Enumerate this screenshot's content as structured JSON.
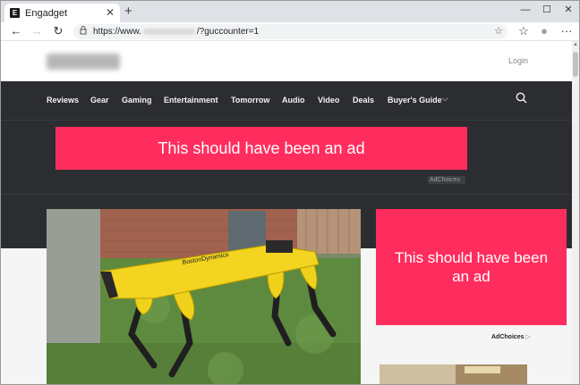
{
  "browser": {
    "tab_title": "Engadget",
    "tab_favicon": "E",
    "tab_close": "✕",
    "new_tab": "+",
    "window_controls": {
      "minimize": "—",
      "maximize": "☐",
      "close": "✕"
    },
    "nav_buttons": {
      "back": "←",
      "forward": "→",
      "reload": "↻"
    },
    "url_prefix": "https://www.",
    "url_suffix": "/?guccounter=1",
    "toolbar_right": {
      "favorites": "☆",
      "collections": "☆",
      "profile": "●",
      "more": "···"
    }
  },
  "site": {
    "login_label": "Login",
    "nav_items": [
      "Reviews",
      "Gear",
      "Gaming",
      "Entertainment",
      "Tomorrow",
      "Audio",
      "Video",
      "Deals",
      "Buyer's Guide"
    ],
    "nav_dropdown": "⌵",
    "search_icon": "⌕"
  },
  "ads": {
    "top_text": "This should have been an ad",
    "top_adchoices": "AdChoices",
    "side_text": "This should have been an ad",
    "side_adchoices": "AdChoices",
    "side_adchoices_icon": "▷"
  },
  "article": {
    "robot_brand_text": "BostonDynamics"
  },
  "colors": {
    "nav_bg": "#2c2d30",
    "ad_pink": "#ff2d5e",
    "tab_strip": "#dee1e6"
  }
}
